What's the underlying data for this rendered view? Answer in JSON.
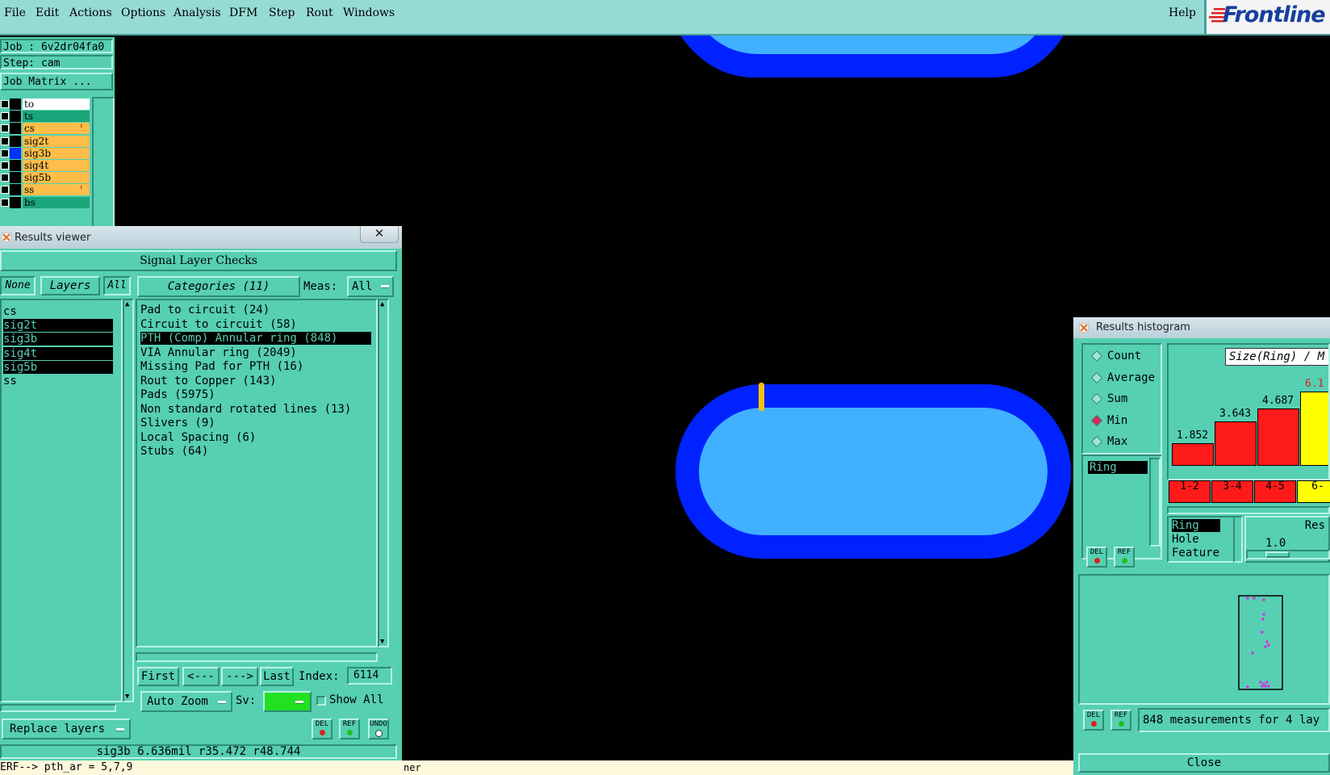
{
  "menu": {
    "items": [
      "File",
      "Edit",
      "Actions",
      "Options",
      "Analysis",
      "DFM",
      "Step",
      "Rout",
      "Windows"
    ],
    "help": "Help",
    "logo": "Frontline"
  },
  "job": {
    "job_line": "Job : 6v2dr04fa0",
    "step_line": "Step: cam",
    "matrix_button": "Job Matrix ...",
    "layers": [
      {
        "name": "to",
        "color": "#ffffff",
        "marker": "",
        "swatch": "#000000"
      },
      {
        "name": "ts",
        "color": "#1aa57a",
        "marker": "",
        "swatch": "#000000"
      },
      {
        "name": "cs",
        "color": "#ffbe4a",
        "marker": "⬆",
        "swatch": "#000000"
      },
      {
        "name": "sig2t",
        "color": "#ffbe4a",
        "marker": "",
        "swatch": "#000000"
      },
      {
        "name": "sig3b",
        "color": "#ffbe4a",
        "marker": "",
        "swatch": "#0033ff"
      },
      {
        "name": "sig4t",
        "color": "#ffbe4a",
        "marker": "",
        "swatch": "#000000"
      },
      {
        "name": "sig5b",
        "color": "#ffbe4a",
        "marker": "",
        "swatch": "#000000"
      },
      {
        "name": "ss",
        "color": "#ffbe4a",
        "marker": "⬆",
        "swatch": "#000000"
      },
      {
        "name": "bs",
        "color": "#1aa57a",
        "marker": "",
        "swatch": "#000000"
      }
    ]
  },
  "results_viewer": {
    "title": "Results viewer",
    "header": "Signal Layer Checks",
    "none_btn": "None",
    "layers_btn": "Layers",
    "all_btn": "All",
    "layer_list": [
      {
        "name": "cs",
        "selected": false
      },
      {
        "name": "sig2t",
        "selected": true
      },
      {
        "name": "sig3b",
        "selected": true
      },
      {
        "name": "sig4t",
        "selected": true
      },
      {
        "name": "sig5b",
        "selected": true
      },
      {
        "name": "ss",
        "selected": false
      }
    ],
    "categories_btn": "Categories (11)",
    "meas_label": "Meas:",
    "meas_value": "All",
    "categories": [
      {
        "text": "Pad to circuit (24)",
        "selected": false
      },
      {
        "text": "Circuit to circuit (58)",
        "selected": false
      },
      {
        "text": "PTH (Comp) Annular ring (848)",
        "selected": true
      },
      {
        "text": "VIA Annular ring (2049)",
        "selected": false
      },
      {
        "text": "Missing Pad for PTH (16)",
        "selected": false
      },
      {
        "text": "Rout to Copper (143)",
        "selected": false
      },
      {
        "text": "Pads (5975)",
        "selected": false
      },
      {
        "text": "Non standard rotated lines (13)",
        "selected": false
      },
      {
        "text": "Slivers (9)",
        "selected": false
      },
      {
        "text": "Local Spacing (6)",
        "selected": false
      },
      {
        "text": "Stubs (64)",
        "selected": false
      }
    ],
    "first_btn": "First",
    "prev_btn": "<---",
    "next_btn": "--->",
    "last_btn": "Last",
    "index_label": "Index:",
    "index_value": "6114",
    "auto_zoom": "Auto Zoom",
    "sv_label": "Sv:",
    "show_all": "Show All",
    "replace_layers": "Replace layers",
    "del": "DEL",
    "ref": "REF",
    "undo": "UNDO",
    "status_line": "sig3b 6.636mil  r35.472  r48.744",
    "bottom_line": "ERF--> pth_ar = 5,7,9",
    "bottom_frag": "ner"
  },
  "histogram": {
    "title": "Results histogram",
    "modes": [
      {
        "label": "Count",
        "on": false
      },
      {
        "label": "Average",
        "on": false
      },
      {
        "label": "Sum",
        "on": false
      },
      {
        "label": "Min",
        "on": true
      },
      {
        "label": "Max",
        "on": false
      }
    ],
    "meas_list_top": "Ring",
    "size_label": "Size(Ring) / M",
    "bars": [
      {
        "value": "1.852",
        "bin": "1-2",
        "color": "#ff1a1a"
      },
      {
        "value": "3.643",
        "bin": "3-4",
        "color": "#ff1a1a"
      },
      {
        "value": "4.687",
        "bin": "4-5",
        "color": "#ff1a1a"
      },
      {
        "value": "6.1",
        "bin": "6-",
        "color": "#ffff00"
      }
    ],
    "measure_types": [
      {
        "label": "Ring",
        "selected": true
      },
      {
        "label": "Hole",
        "selected": false
      },
      {
        "label": "Feature",
        "selected": false
      }
    ],
    "res_label": "Res",
    "res_value": "1.0",
    "summary": "848 measurements for 4 lay",
    "close": "Close"
  },
  "colors": {
    "panel": "#56cfb2",
    "menubar": "#96dad6",
    "pad_outer": "#0022ff",
    "pad_inner": "#40b0ff",
    "marker": "#ffc000"
  }
}
